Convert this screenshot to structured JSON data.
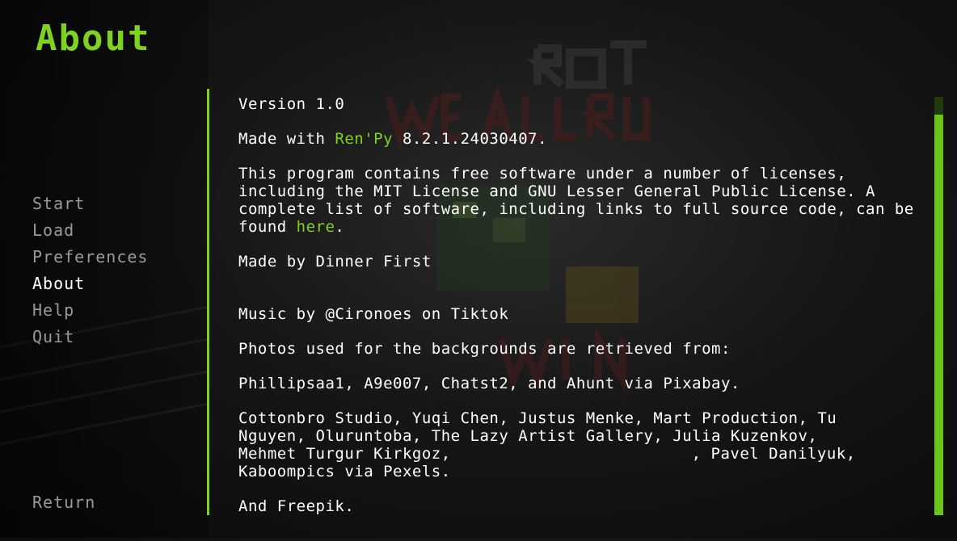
{
  "screen": {
    "title": "About"
  },
  "nav": {
    "items": [
      "Start",
      "Load",
      "Preferences",
      "About",
      "Help",
      "Quit"
    ],
    "return_label": "Return"
  },
  "about": {
    "version": "Version 1.0",
    "made_with_prefix": "Made with ",
    "engine_link": "Ren'Py",
    "made_with_suffix": " 8.2.1.24030407.",
    "license_text": "This program contains free software under a number of licenses, including the MIT License and GNU Lesser General Public License. A complete list of software, including links to full source code, can be found ",
    "license_link": "here",
    "license_end": ".",
    "made_by": "Made by Dinner First",
    "music": "Music by @Cironoes on Tiktok",
    "photos_intro": "Photos used for the backgrounds are retrieved from:",
    "pixabay": "Phillipsaa1, A9e007, Chatst2, and Ahunt via Pixabay.",
    "pexels_line1": "Cottonbro Studio, Yuqi Chen, Justus Menke, Mart Production, Tu",
    "pexels_line2": "Nguyen, Oluruntoba, The Lazy Artist Gallery, Julia Kuzenkov,",
    "pexels_line3a": "Mehmet Turgur Kirkgoz,",
    "pexels_line3b": ", Pavel Danilyuk,",
    "pexels_line4": "Kaboompics via Pexels.",
    "freepik": "And Freepik."
  },
  "colors": {
    "accent": "#7ed321",
    "nav_idle": "#9a9a9a",
    "scroll_track": "#1d3b0c"
  },
  "scrollbar": {
    "position_fraction": 0.0
  }
}
